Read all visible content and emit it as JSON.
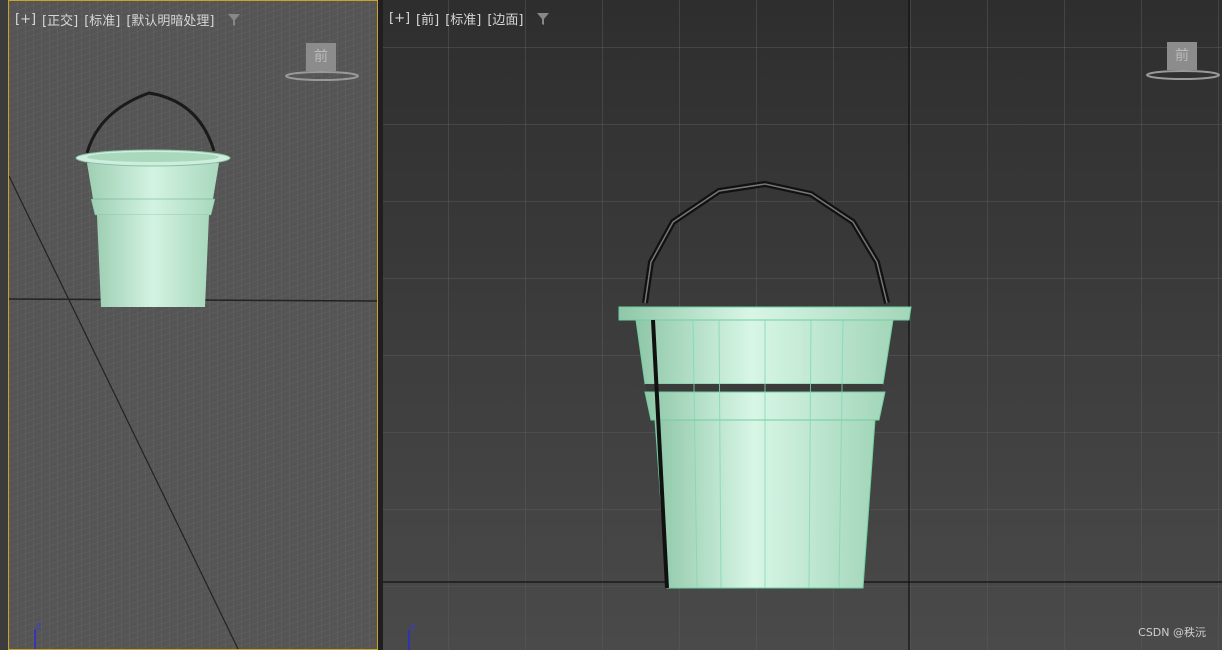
{
  "left_viewport": {
    "menu_plus": "[+]",
    "view_mode": "[正交]",
    "shading": "[标准]",
    "lighting": "[默认明暗处理]",
    "navcube_label": "前",
    "axis_label": "z"
  },
  "right_viewport": {
    "menu_plus": "[+]",
    "view_mode": "[前]",
    "shading": "[标准]",
    "display": "[边面]",
    "navcube_label": "前",
    "axis_label": "z"
  },
  "watermark": "CSDN @秩沅",
  "icons": {
    "filter": "filter-icon",
    "axis": "axis-gizmo-icon"
  },
  "colors": {
    "active_border": "#c9a227",
    "bucket_fill": "#bfe8d2",
    "bucket_edge": "#7fdab0"
  }
}
